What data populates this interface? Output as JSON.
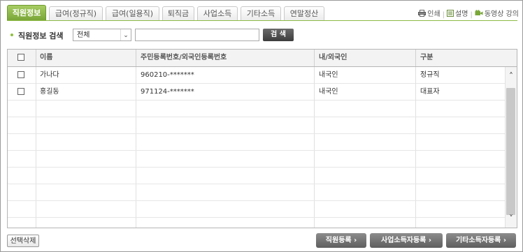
{
  "tabs": [
    {
      "label": "직원정보",
      "active": true
    },
    {
      "label": "급여(정규직)"
    },
    {
      "label": "급여(일용직)"
    },
    {
      "label": "퇴직금"
    },
    {
      "label": "사업소득"
    },
    {
      "label": "기타소득"
    },
    {
      "label": "연말정산"
    }
  ],
  "top_links": {
    "print": "인쇄",
    "help": "설명",
    "video": "동영상 강의"
  },
  "search": {
    "label": "직원정보 검색",
    "select_value": "전체",
    "input_value": "",
    "button_label": "검 색"
  },
  "table": {
    "columns": [
      "",
      "이름",
      "주민등록번호/외국인등록번호",
      "내/외국인",
      "구분"
    ],
    "rows": [
      {
        "name": "가나다",
        "id_number": "960210-*******",
        "nationality": "내국인",
        "type": "정규직"
      },
      {
        "name": "홍길동",
        "id_number": "971124-*******",
        "nationality": "내국인",
        "type": "대표자"
      }
    ]
  },
  "buttons": {
    "delete_selected": "선택삭제",
    "register_employee": "직원등록 ›",
    "register_business_earner": "사업소득자등록 ›",
    "register_other_earner": "기타소득자등록 ›"
  },
  "colors": {
    "accent_green": "#8dba45",
    "tab_active": "#79a638",
    "dark_button": "#5e5e5e"
  }
}
